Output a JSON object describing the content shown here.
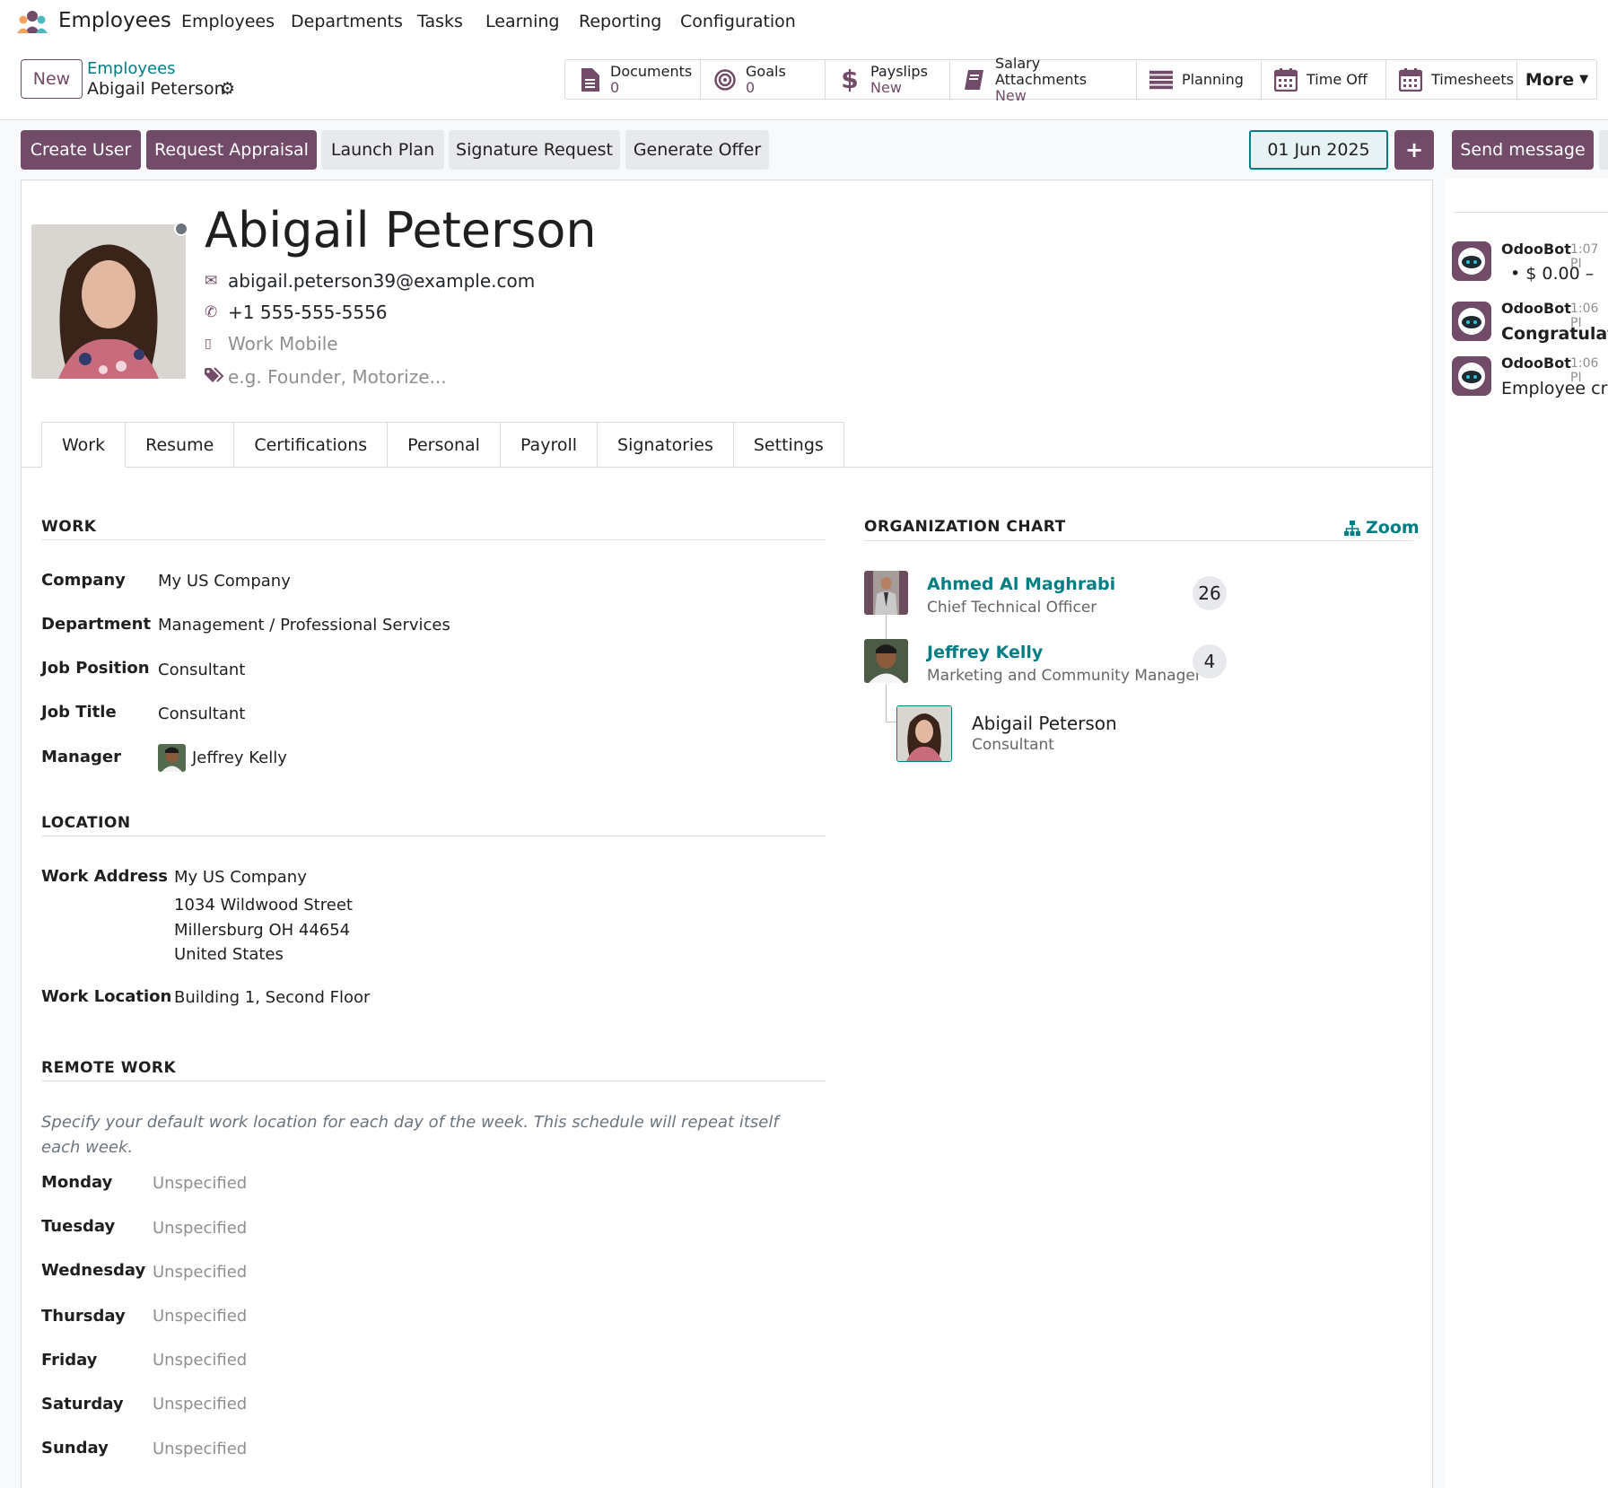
{
  "app": {
    "name": "Employees",
    "logo_icon": "employees-app-icon"
  },
  "menu": [
    "Employees",
    "Departments",
    "Tasks",
    "Learning",
    "Reporting",
    "Configuration"
  ],
  "control_panel": {
    "new_label": "New",
    "breadcrumb_parent": "Employees",
    "breadcrumb_current": "Abigail Peterson"
  },
  "smart_buttons": [
    {
      "label": "Documents",
      "value": "0",
      "icon": "document-icon"
    },
    {
      "label": "Goals",
      "value": "0",
      "icon": "target-icon"
    },
    {
      "label": "Payslips",
      "value": "New",
      "icon": "dollar-icon"
    },
    {
      "label": "Salary Attachments",
      "value": "New",
      "icon": "book-icon"
    },
    {
      "label": "Planning",
      "value": "",
      "icon": "planning-icon"
    },
    {
      "label": "Time Off",
      "value": "",
      "icon": "calendar-icon"
    },
    {
      "label": "Timesheets",
      "value": "",
      "icon": "calendar-icon"
    }
  ],
  "more_label": "More",
  "actions": {
    "create_user": "Create User",
    "request_appraisal": "Request Appraisal",
    "launch_plan": "Launch Plan",
    "signature_request": "Signature Request",
    "generate_offer": "Generate Offer",
    "date": "01 Jun 2025",
    "send_message": "Send message"
  },
  "employee": {
    "name": "Abigail Peterson",
    "email": "abigail.peterson39@example.com",
    "phone": "+1 555-555-5556",
    "mobile_placeholder": "Work Mobile",
    "tags_placeholder": "e.g. Founder, Motorize..."
  },
  "tabs": [
    "Work",
    "Resume",
    "Certifications",
    "Personal",
    "Payroll",
    "Signatories",
    "Settings"
  ],
  "work": {
    "title": "WORK",
    "fields": [
      {
        "label": "Company",
        "value": "My US Company"
      },
      {
        "label": "Department",
        "value": "Management / Professional Services"
      },
      {
        "label": "Job Position",
        "value": "Consultant"
      },
      {
        "label": "Job Title",
        "value": "Consultant"
      },
      {
        "label": "Manager",
        "value": "Jeffrey Kelly"
      }
    ]
  },
  "location": {
    "title": "LOCATION",
    "address_label": "Work Address",
    "address_lines": [
      "My US Company",
      "1034 Wildwood Street",
      "Millersburg OH 44654",
      "United States"
    ],
    "location_label": "Work Location",
    "location_value": "Building 1, Second Floor"
  },
  "remote": {
    "title": "REMOTE WORK",
    "hint": "Specify your default work location for each day of the week. This schedule will repeat itself each week.",
    "days": [
      {
        "day": "Monday",
        "value": "Unspecified"
      },
      {
        "day": "Tuesday",
        "value": "Unspecified"
      },
      {
        "day": "Wednesday",
        "value": "Unspecified"
      },
      {
        "day": "Thursday",
        "value": "Unspecified"
      },
      {
        "day": "Friday",
        "value": "Unspecified"
      },
      {
        "day": "Saturday",
        "value": "Unspecified"
      },
      {
        "day": "Sunday",
        "value": "Unspecified"
      }
    ]
  },
  "org_chart": {
    "title": "ORGANIZATION CHART",
    "zoom_label": "Zoom",
    "managers": [
      {
        "name": "Ahmed Al Maghrabi",
        "job": "Chief Technical Officer",
        "count": "26"
      },
      {
        "name": "Jeffrey Kelly",
        "job": "Marketing and Community Manager",
        "count": "4"
      }
    ],
    "self": {
      "name": "Abigail Peterson",
      "job": "Consultant"
    }
  },
  "chatter": [
    {
      "author": "OdooBot",
      "time": "1:07 PI",
      "message": "•   $ 0.00  –"
    },
    {
      "author": "OdooBot",
      "time": "1:06 PI",
      "message": "Congratulatio"
    },
    {
      "author": "OdooBot",
      "time": "1:06 PI",
      "message": "Employee crea"
    }
  ],
  "colors": {
    "primary": "#714b67",
    "link": "#017e84",
    "muted": "#8f8f8f"
  }
}
